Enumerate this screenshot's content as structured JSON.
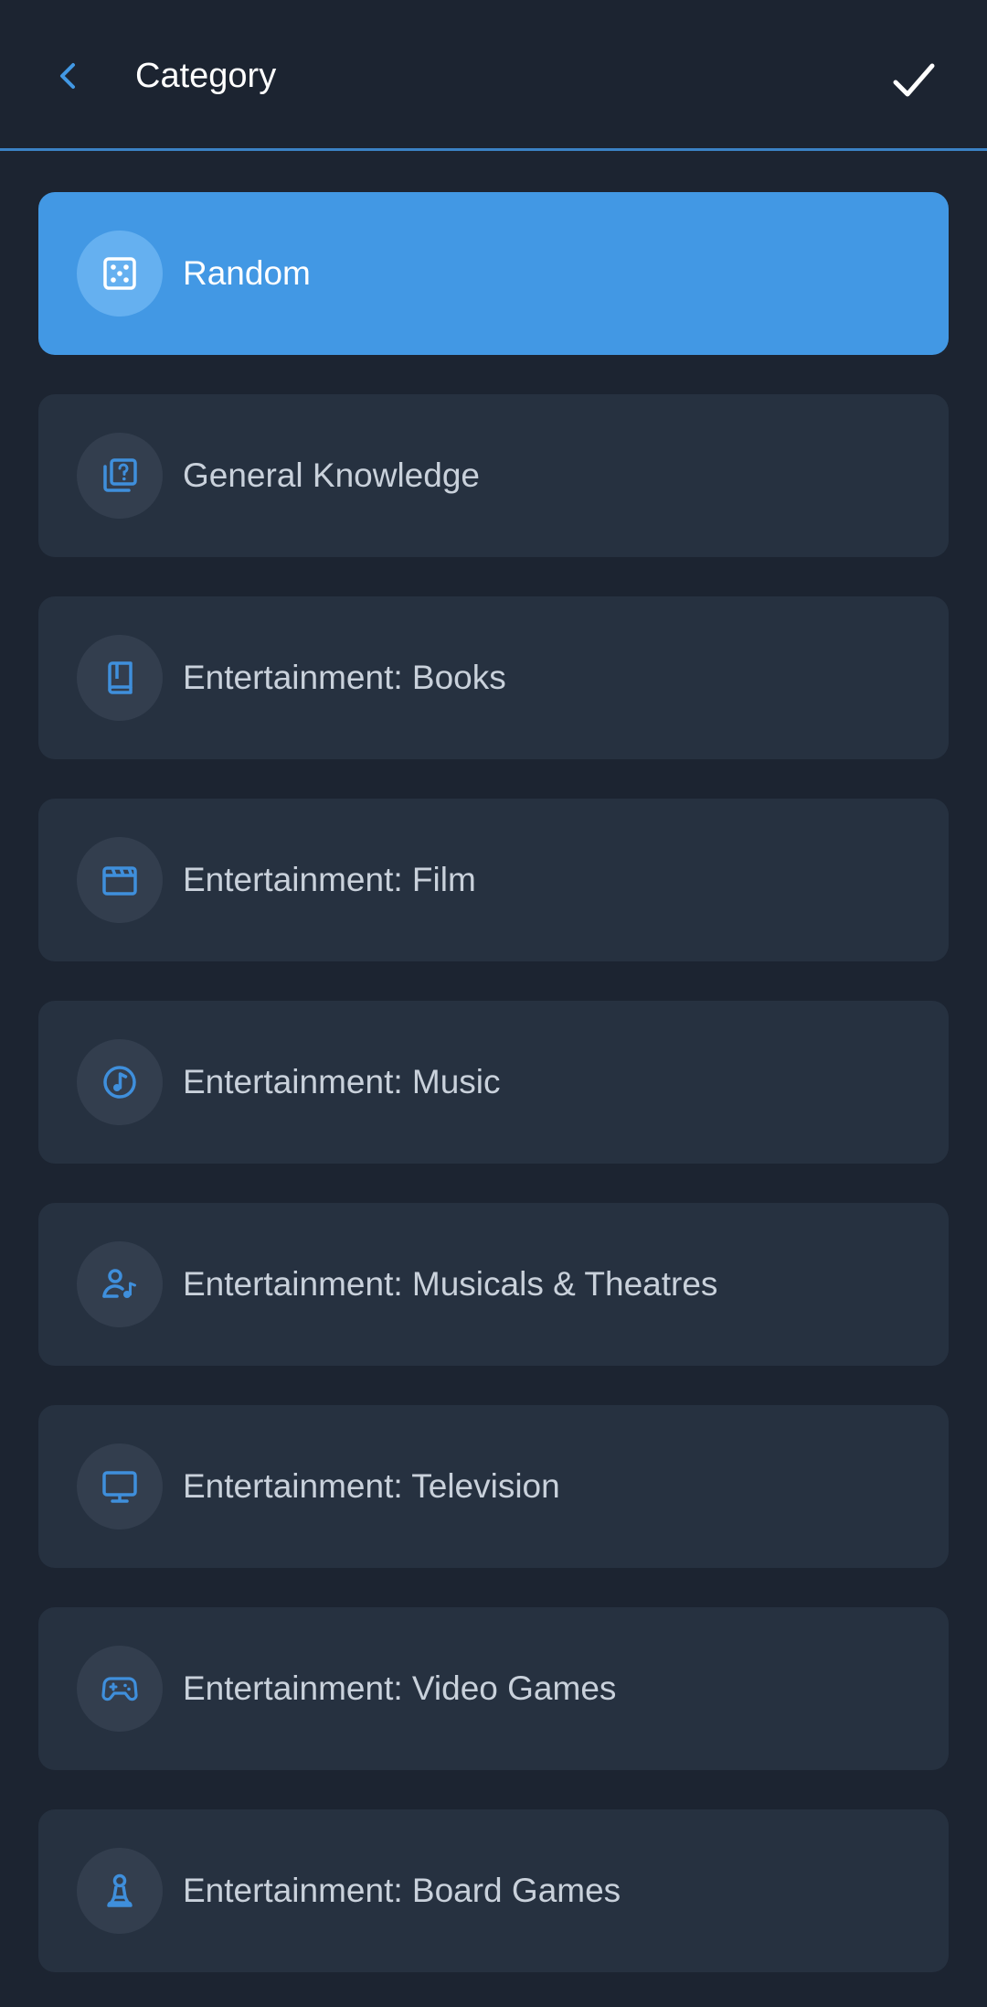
{
  "header": {
    "title": "Category",
    "back_icon": "chevron-left-icon",
    "confirm_icon": "checkmark-icon",
    "accent_color": "#3b82c4"
  },
  "categories": [
    {
      "label": "Random",
      "icon": "dice-icon",
      "selected": true
    },
    {
      "label": "General Knowledge",
      "icon": "question-cards-icon",
      "selected": false
    },
    {
      "label": "Entertainment: Books",
      "icon": "book-icon",
      "selected": false
    },
    {
      "label": "Entertainment: Film",
      "icon": "clapperboard-icon",
      "selected": false
    },
    {
      "label": "Entertainment: Music",
      "icon": "music-note-icon",
      "selected": false
    },
    {
      "label": "Entertainment: Musicals & Theatres",
      "icon": "singer-icon",
      "selected": false
    },
    {
      "label": "Entertainment: Television",
      "icon": "television-icon",
      "selected": false
    },
    {
      "label": "Entertainment: Video Games",
      "icon": "gamepad-icon",
      "selected": false
    },
    {
      "label": "Entertainment: Board Games",
      "icon": "chess-pawn-icon",
      "selected": false
    }
  ],
  "colors": {
    "background": "#1c2431",
    "card": "#263140",
    "selected_card": "#4298e4",
    "icon_blue": "#3f8fdc"
  }
}
